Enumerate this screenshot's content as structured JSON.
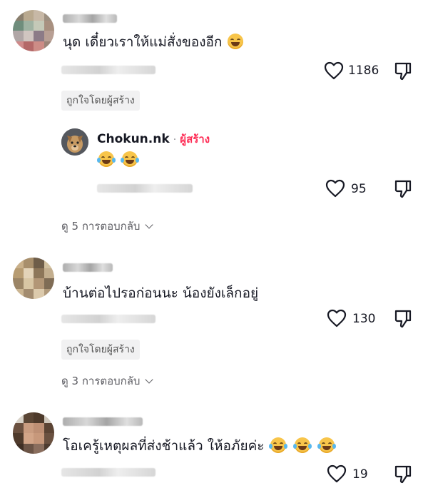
{
  "comments": [
    {
      "text": "นุด เดี๋ยวเราให้แม่สั่งของอีก",
      "emoji": "grinning-face",
      "likes": "1186",
      "liked_by_creator": "ถูกใจโดยผู้สร้าง",
      "reply": {
        "username": "Chokun.nk",
        "separator": "·",
        "creator_label": "ผู้สร้าง",
        "emojis": [
          "laughing-tears-face",
          "laughing-tears-face"
        ],
        "likes": "95"
      },
      "view_replies": "ดู 5 การตอบกลับ"
    },
    {
      "text": "บ้านต่อไปรอก่อนนะ  น้องยังเล็กอยู่",
      "likes": "130",
      "liked_by_creator": "ถูกใจโดยผู้สร้าง",
      "view_replies": "ดู 3 การตอบกลับ"
    },
    {
      "text": "โอเครู้เหตุผลที่ส่งช้าแล้ว ให้อภัยค่ะ",
      "emojis": [
        "laughing-tears-face",
        "laughing-tears-face",
        "laughing-tears-face"
      ],
      "likes": "19"
    }
  ],
  "colors": {
    "creator_accent": "#fe2c55",
    "text": "#161823",
    "muted": "#5c5c62"
  },
  "icons": [
    "heart-outline-icon",
    "dislike-icon",
    "chevron-down-icon"
  ]
}
